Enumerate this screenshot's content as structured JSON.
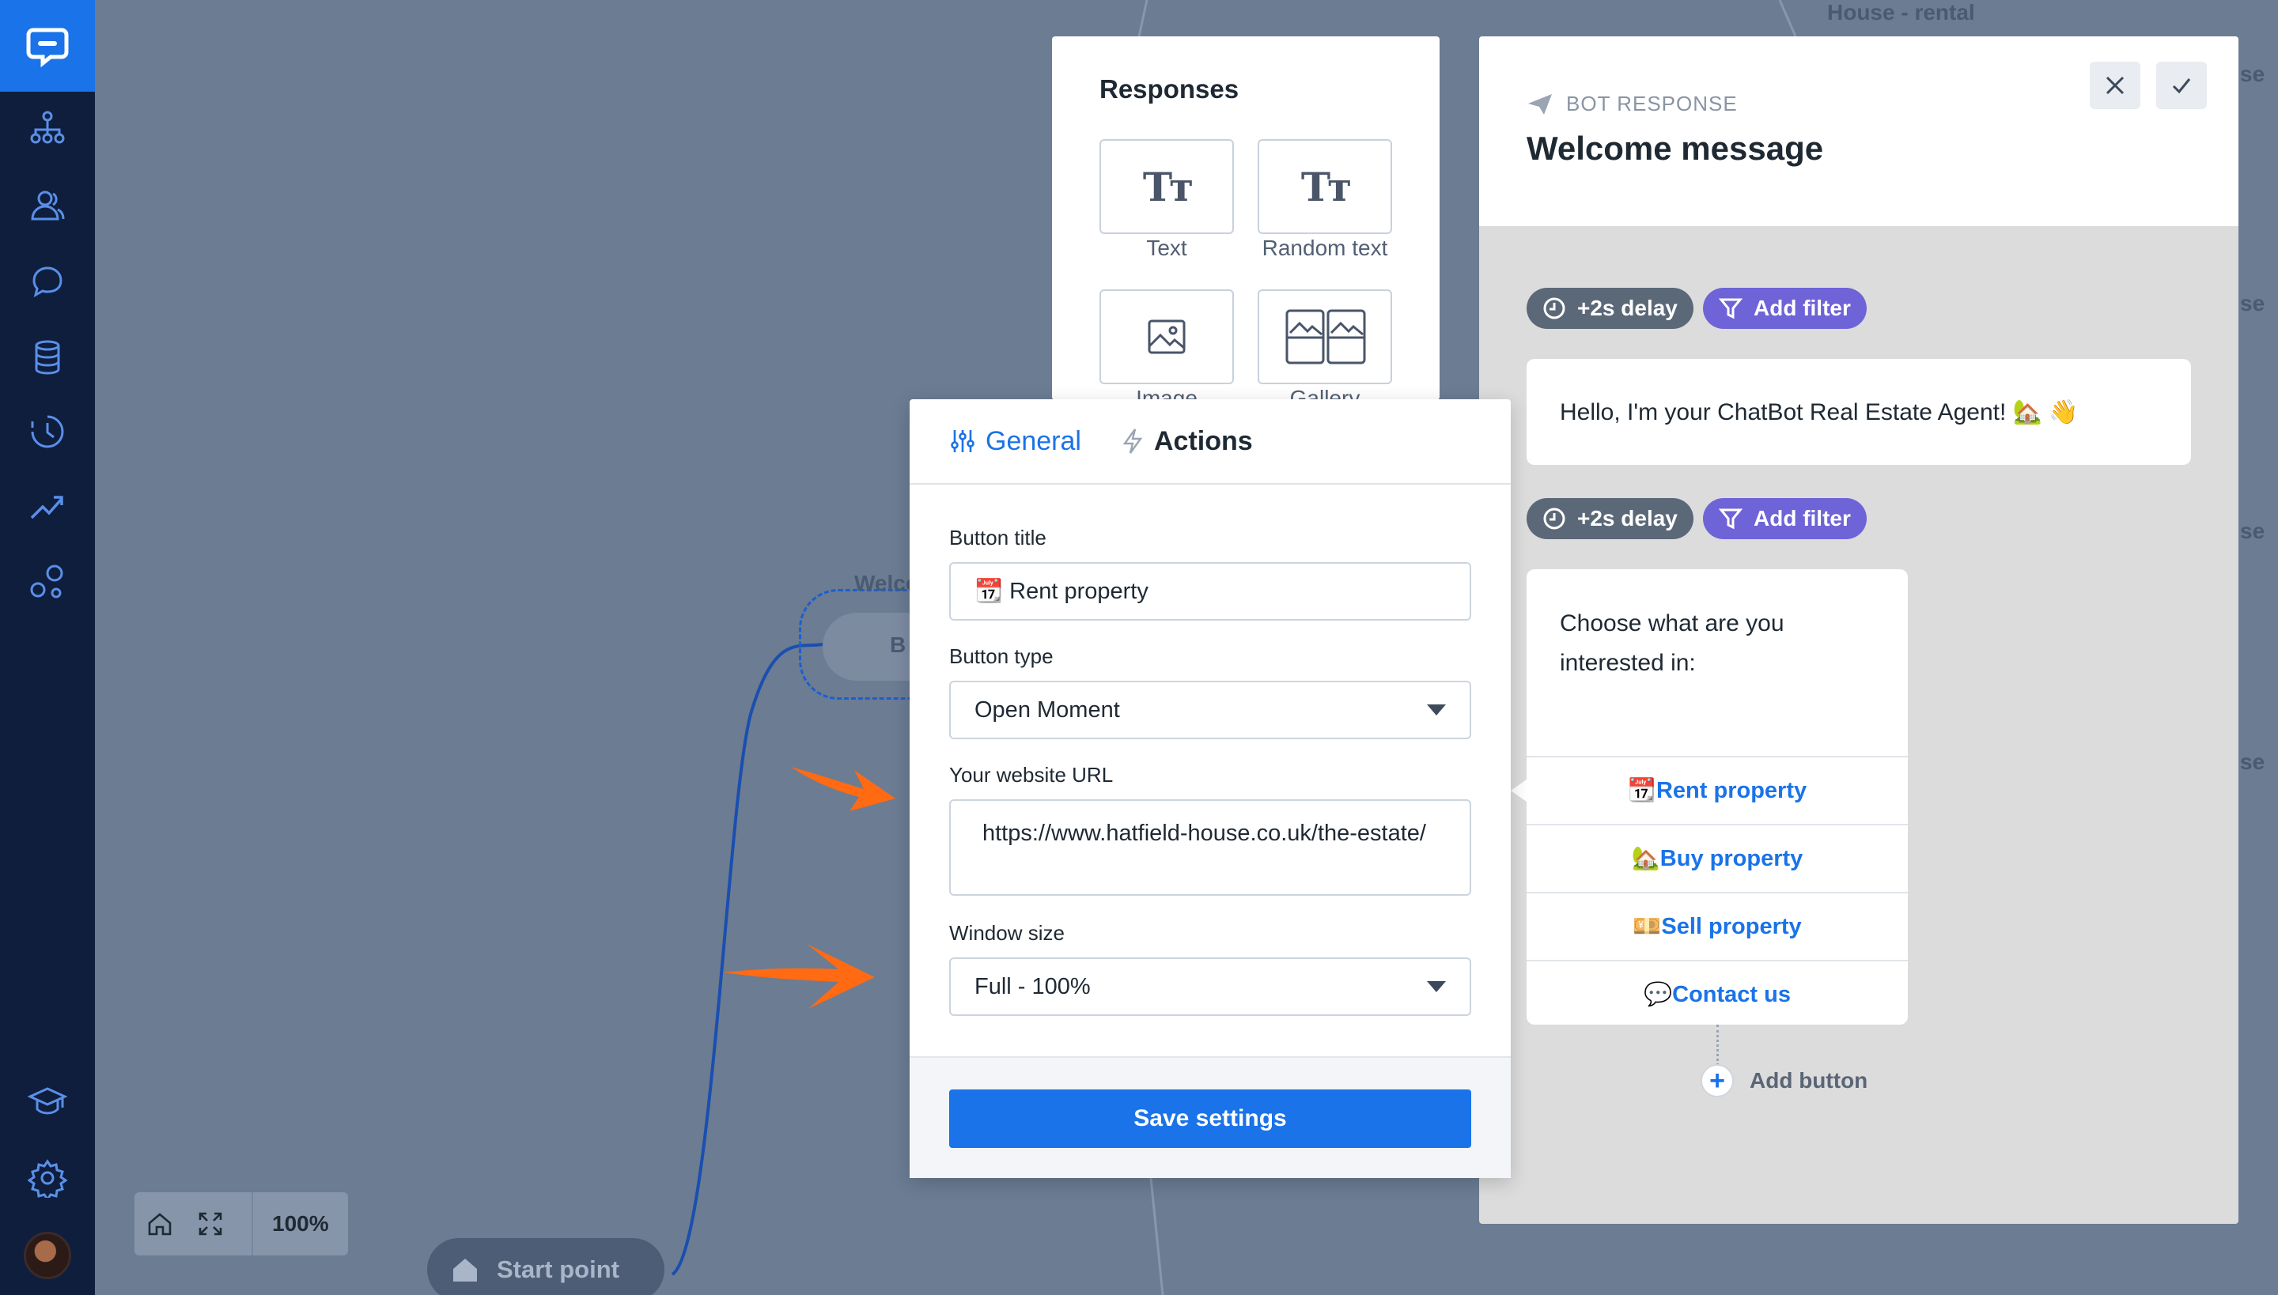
{
  "sidebar": {
    "logo_icon": "chat-bubble-icon",
    "items": [
      {
        "name": "stories-icon"
      },
      {
        "name": "audience-icon"
      },
      {
        "name": "training-icon"
      },
      {
        "name": "data-icon"
      },
      {
        "name": "history-icon"
      },
      {
        "name": "reports-icon"
      },
      {
        "name": "integrations-icon"
      }
    ],
    "bottom": [
      {
        "name": "academy-icon"
      },
      {
        "name": "settings-icon"
      }
    ]
  },
  "canvas": {
    "start_point": "Start point",
    "zoom": "100%",
    "welcome_edge": "Welco",
    "node_fragment": "B",
    "house_rental": "House - rental",
    "right_fragments": [
      "se",
      "se",
      "se",
      "se"
    ],
    "bot_response_fragment": "Bot response"
  },
  "responses_panel": {
    "title": "Responses",
    "items": [
      {
        "label": "Text",
        "icon": "text-icon"
      },
      {
        "label": "Random text",
        "icon": "random-text-icon"
      },
      {
        "label": "Image",
        "icon": "image-icon"
      },
      {
        "label": "Gallery",
        "icon": "gallery-icon"
      }
    ]
  },
  "settings_popup": {
    "tabs": [
      {
        "label": "General",
        "icon": "sliders-icon",
        "active": true
      },
      {
        "label": "Actions",
        "icon": "lightning-icon",
        "active": false
      }
    ],
    "button_title": {
      "label": "Button title",
      "value": "📆 Rent property"
    },
    "button_type": {
      "label": "Button type",
      "value": "Open Moment"
    },
    "website_url": {
      "label": "Your website URL",
      "value": "https://www.hatfield-house.co.uk/the-estate/"
    },
    "window_size": {
      "label": "Window size",
      "value": "Full - 100%"
    },
    "save_label": "Save settings"
  },
  "bot_response": {
    "kicker": "BOT RESPONSE",
    "title": "Welcome message",
    "delay_label": "+2s delay",
    "filter_label": "Add filter",
    "message": "Hello, I'm your ChatBot Real Estate Agent! 🏡 👋",
    "question": "Choose what are you interested in:",
    "buttons": [
      {
        "label": "📆Rent property"
      },
      {
        "label": "🏡Buy property"
      },
      {
        "label": "💴Sell property"
      },
      {
        "label": "💬Contact us"
      }
    ],
    "add_button": "Add button"
  },
  "colors": {
    "accent": "#1a73e8",
    "sidebar": "#0f1e3d",
    "canvas": "#6b7c93",
    "filter_pill": "#6f63d8",
    "arrow": "#ff6a13"
  }
}
